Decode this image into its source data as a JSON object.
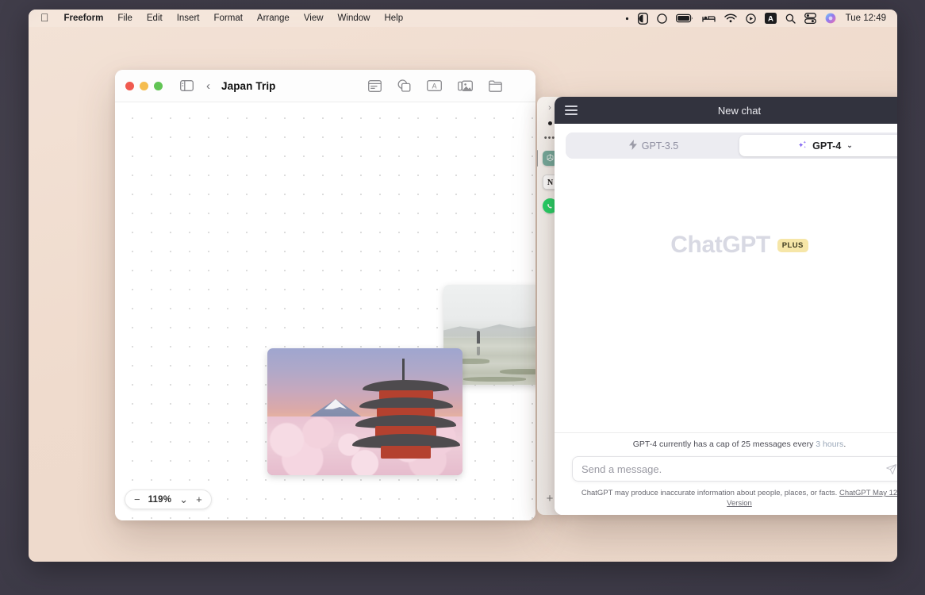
{
  "menubar": {
    "apple_icon": "apple-logo",
    "items": [
      {
        "label": "Freeform",
        "bold": true
      },
      {
        "label": "File"
      },
      {
        "label": "Edit"
      },
      {
        "label": "Insert"
      },
      {
        "label": "Format"
      },
      {
        "label": "Arrange"
      },
      {
        "label": "View"
      },
      {
        "label": "Window"
      },
      {
        "label": "Help"
      }
    ],
    "status_icons": [
      "small-dot-icon",
      "do-not-disturb-icon",
      "circle-icon",
      "battery-icon",
      "sleep-bed-icon",
      "wifi-icon",
      "now-playing-icon",
      "input-source-A-icon",
      "spotlight-search-icon",
      "control-center-icon",
      "siri-orb-icon"
    ],
    "clock": "Tue 12:49"
  },
  "freeform": {
    "title": "Japan Trip",
    "traffic_lights": [
      "close",
      "minimize",
      "zoom"
    ],
    "sidebar_toggle": "sidebar-toggle-icon",
    "back": "‹",
    "tools": [
      {
        "name": "sticky-note-icon"
      },
      {
        "name": "shapes-icon"
      },
      {
        "name": "text-box-icon"
      },
      {
        "name": "media-icon"
      },
      {
        "name": "insert-file-icon"
      }
    ],
    "zoom_control": {
      "minus": "−",
      "value": "119%",
      "chevron": "⌄",
      "plus": "+"
    },
    "canvas_items": [
      {
        "name": "photo-torii-gate",
        "alt": "Torii gate at low tide with person walking"
      },
      {
        "name": "photo-pagoda-fuji",
        "alt": "Chureito Pagoda with Mt. Fuji and cherry blossoms"
      }
    ]
  },
  "dock": {
    "chevron": "›",
    "dot": "recording-dot-icon",
    "more": "•••",
    "apps": [
      {
        "name": "chatgpt",
        "label": "ChatGPT",
        "selected": true
      },
      {
        "name": "notion",
        "label": "N",
        "selected": false
      },
      {
        "name": "whatsapp",
        "label": "WhatsApp",
        "selected": false
      }
    ],
    "add": "+"
  },
  "chatgpt": {
    "header": {
      "menu_icon": "hamburger-menu-icon",
      "title": "New chat",
      "new_chat_icon": "+"
    },
    "models": [
      {
        "label": "GPT-3.5",
        "icon": "lightning-bolt-icon",
        "active": false
      },
      {
        "label": "GPT-4",
        "icon": "sparkle-icon",
        "active": true,
        "chevron": "⌄"
      }
    ],
    "watermark": {
      "text": "ChatGPT",
      "badge": "PLUS"
    },
    "cap_notice": {
      "text": "GPT-4 currently has a cap of 25 messages every ",
      "highlight": "3 hours",
      "tail": "."
    },
    "composer": {
      "placeholder": "Send a message.",
      "send_icon": "send-paper-plane-icon"
    },
    "disclaimer": {
      "text": "ChatGPT may produce inaccurate information about people, places, or facts. ",
      "link": "ChatGPT May 12 Version"
    }
  },
  "colors": {
    "desktop": "#efdbcd",
    "outer": "#413e4c",
    "chat_header": "#32333e",
    "accent_purple": "#7a5cf0",
    "plus_badge": "#f6e6a8",
    "cursor_blob": "#9be4ea"
  }
}
